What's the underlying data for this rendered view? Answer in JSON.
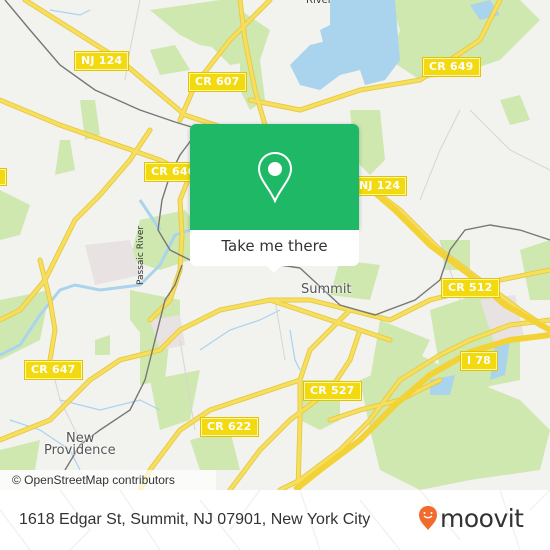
{
  "map": {
    "road_labels": [
      {
        "id": "nj124-west",
        "text": "NJ 124"
      },
      {
        "id": "cr607",
        "text": "CR 607"
      },
      {
        "id": "cr649",
        "text": "CR 649"
      },
      {
        "id": "cr646",
        "text": "CR 646"
      },
      {
        "id": "nj124-east",
        "text": "NJ 124"
      },
      {
        "id": "cr512",
        "text": "CR 512"
      },
      {
        "id": "i78",
        "text": "I 78"
      },
      {
        "id": "cr647",
        "text": "CR 647"
      },
      {
        "id": "cr527",
        "text": "CR 527"
      },
      {
        "id": "cr622",
        "text": "CR 622"
      }
    ],
    "place_labels": {
      "summit": "Summit",
      "new_providence_line1": "New",
      "new_providence_line2": "Providence",
      "river_top": "River"
    },
    "water_labels": {
      "passaic_river": "Passaic River"
    },
    "attribution": "© OpenStreetMap contributors",
    "colors": {
      "land": "#f2f2ef",
      "park": "#cfe8b0",
      "water": "#aad3ee",
      "road_major": "#f6df5e",
      "shield": "#f3d90f",
      "rail": "#777777"
    }
  },
  "popup": {
    "icon": "location-pin-icon",
    "button_label": "Take me there",
    "accent_color": "#1fb866"
  },
  "footer": {
    "address": "1618 Edgar St, Summit, NJ 07901, New York City",
    "brand_name": "moovit",
    "brand_color": "#f26a2e"
  }
}
